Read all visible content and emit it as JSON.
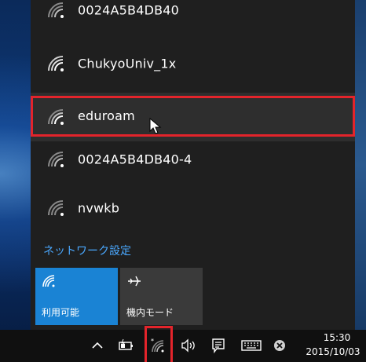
{
  "networks": [
    {
      "ssid": "0024A5B4DB40"
    },
    {
      "ssid": "ChukyoUniv_1x"
    },
    {
      "ssid": "eduroam"
    },
    {
      "ssid": "0024A5B4DB40-4"
    },
    {
      "ssid": "nvwkb"
    }
  ],
  "network_settings_label": "ネットワーク設定",
  "quick_actions": {
    "wifi_label": "利用可能",
    "airplane_label": "機内モード"
  },
  "taskbar": {
    "time": "15:30",
    "date": "2015/10/03"
  },
  "colors": {
    "accent": "#1a83d4",
    "highlight": "#e3242b",
    "link": "#4aa8ff"
  }
}
